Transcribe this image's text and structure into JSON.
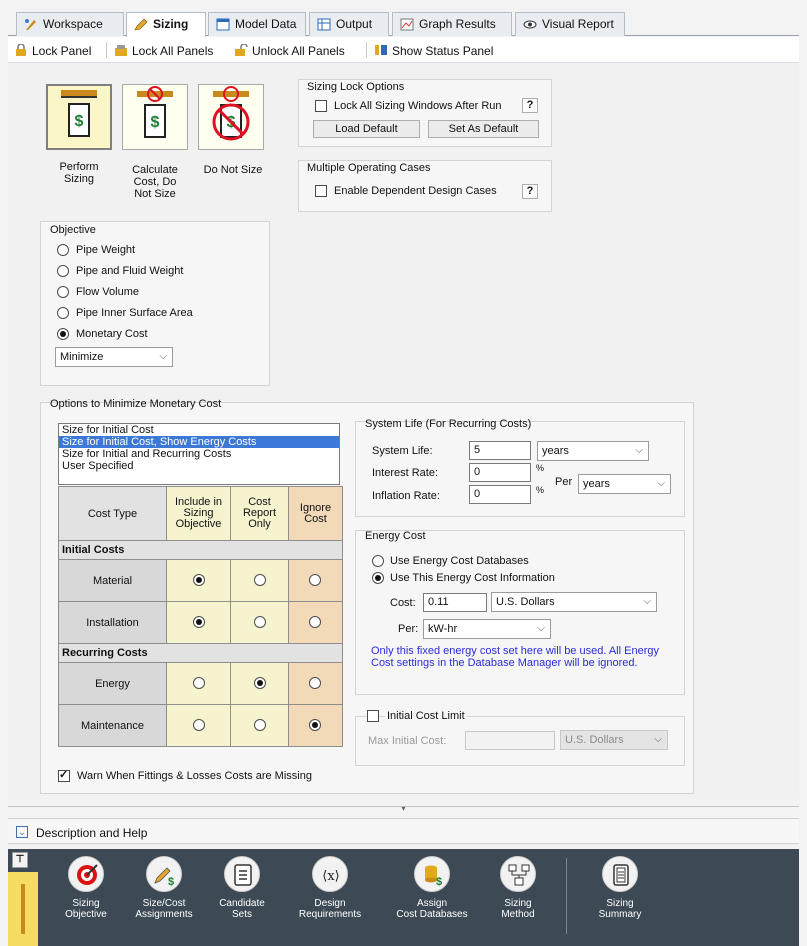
{
  "tabs": [
    {
      "label": "Workspace",
      "icon": "workspace-icon",
      "active": false
    },
    {
      "label": "Sizing",
      "icon": "sizing-pencil-icon",
      "active": true
    },
    {
      "label": "Model Data",
      "icon": "model-data-icon",
      "active": false
    },
    {
      "label": "Output",
      "icon": "output-table-icon",
      "active": false
    },
    {
      "label": "Graph Results",
      "icon": "graph-icon",
      "active": false
    },
    {
      "label": "Visual Report",
      "icon": "eye-icon",
      "active": false
    }
  ],
  "toolbar": {
    "lock_panel": "Lock Panel",
    "lock_all": "Lock All Panels",
    "unlock_all": "Unlock All Panels",
    "show_status": "Show Status Panel"
  },
  "sizing_modes": {
    "perform": "Perform\nSizing",
    "calculate": "Calculate\nCost, Do\nNot Size",
    "do_not_size": "Do Not Size"
  },
  "lock_options": {
    "title": "Sizing Lock Options",
    "checkbox": "Lock All Sizing Windows After Run",
    "checked": false,
    "help": "?",
    "load_default": "Load Default",
    "set_default": "Set As Default"
  },
  "multiple_cases": {
    "title": "Multiple Operating Cases",
    "checkbox": "Enable Dependent Design Cases",
    "checked": false,
    "help": "?"
  },
  "objective": {
    "title": "Objective",
    "options": [
      "Pipe Weight",
      "Pipe and Fluid Weight",
      "Flow Volume",
      "Pipe Inner Surface Area",
      "Monetary Cost"
    ],
    "selected": "Monetary Cost",
    "direction": "Minimize"
  },
  "monetary": {
    "title": "Options to Minimize Monetary Cost",
    "list": [
      "Size for Initial Cost",
      "Size for Initial Cost, Show Energy Costs",
      "Size for Initial and Recurring Costs",
      "User Specified"
    ],
    "list_selected": "Size for Initial Cost, Show Energy Costs",
    "table": {
      "col_cost_type": "Cost Type",
      "col_include": "Include in\nSizing\nObjective",
      "col_report": "Cost\nReport\nOnly",
      "col_ignore": "Ignore\nCost",
      "initial_header": "Initial Costs",
      "recurring_header": "Recurring Costs",
      "rows": [
        {
          "name": "Material",
          "selected": 0
        },
        {
          "name": "Installation",
          "selected": 0
        },
        {
          "name": "Energy",
          "selected": 1
        },
        {
          "name": "Maintenance",
          "selected": 2
        }
      ]
    },
    "warn_checkbox": "Warn When Fittings & Losses Costs are Missing",
    "warn_checked": true
  },
  "system_life": {
    "title": "System Life (For Recurring Costs)",
    "life_label": "System Life:",
    "life_value": "5",
    "life_unit": "years",
    "interest_label": "Interest Rate:",
    "interest_value": "0",
    "inflation_label": "Inflation Rate:",
    "inflation_value": "0",
    "pct": "%",
    "per": "Per",
    "per_unit": "years"
  },
  "energy_cost": {
    "title": "Energy Cost",
    "opt1": "Use Energy Cost Databases",
    "opt2": "Use This Energy Cost Information",
    "selected": "Use This Energy Cost Information",
    "cost_label": "Cost:",
    "cost_value": "0.11",
    "currency": "U.S. Dollars",
    "per_label": "Per:",
    "per_value": "kW-hr",
    "note": "Only this fixed energy cost set here will be used. All Energy Cost settings in the Database Manager will be ignored.",
    "note_color": "#2b2bd6"
  },
  "initial_limit": {
    "checkbox": "Initial Cost Limit",
    "checked": false,
    "max_label": "Max Initial Cost:",
    "currency": "U.S. Dollars"
  },
  "description": {
    "label": "Description and Help"
  },
  "bottom_nav": [
    {
      "label": "Sizing\nObjective",
      "icon": "target-icon"
    },
    {
      "label": "Size/Cost\nAssignments",
      "icon": "pencil-dollar-icon"
    },
    {
      "label": "Candidate\nSets",
      "icon": "list-icon"
    },
    {
      "label": "Design\nRequirements",
      "icon": "variable-x-icon"
    },
    {
      "label": "Assign\nCost Databases",
      "icon": "database-dollar-icon"
    },
    {
      "label": "Sizing\nMethod",
      "icon": "network-icon"
    },
    {
      "label": "Sizing\nSummary",
      "icon": "summary-doc-icon"
    }
  ]
}
